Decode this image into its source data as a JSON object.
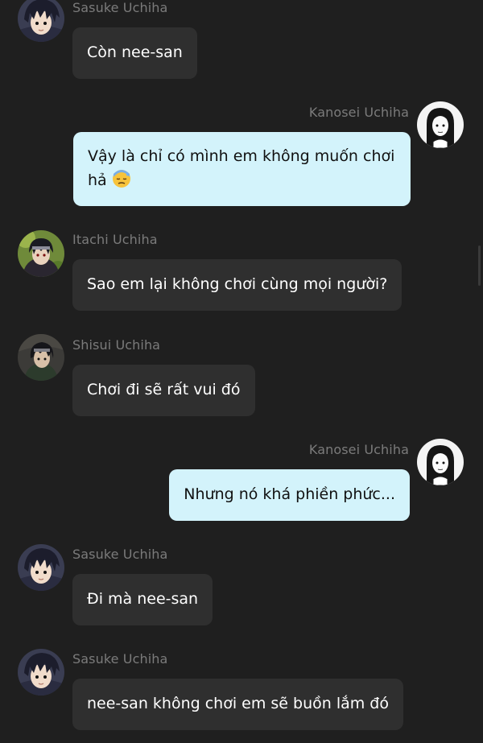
{
  "messages": [
    {
      "sender": "Sasuke Uchiha",
      "avatar": "sasuke-avatar",
      "side": "left",
      "text": "Còn nee-san"
    },
    {
      "sender": "Kanosei Uchiha",
      "avatar": "kanosei-avatar",
      "side": "right",
      "text": "Vậy là chỉ có mình em không muốn chơi hả",
      "emoji": "downcast-sweat-face-icon"
    },
    {
      "sender": "Itachi Uchiha",
      "avatar": "itachi-avatar",
      "side": "left",
      "text": "Sao em lại không chơi cùng mọi người?"
    },
    {
      "sender": "Shisui Uchiha",
      "avatar": "shisui-avatar",
      "side": "left",
      "text": "Chơi đi sẽ rất vui đó"
    },
    {
      "sender": "Kanosei Uchiha",
      "avatar": "kanosei-avatar",
      "side": "right",
      "text": "Nhưng nó khá phiền phức..."
    },
    {
      "sender": "Sasuke Uchiha",
      "avatar": "sasuke-avatar",
      "side": "left",
      "text": "Đi mà nee-san"
    },
    {
      "sender": "Sasuke Uchiha",
      "avatar": "sasuke-avatar",
      "side": "left",
      "text": "nee-san không chơi em sẽ buồn lắm đó"
    }
  ],
  "colors": {
    "background": "#1f1f1f",
    "incoming_bubble": "#2f2f2f",
    "outgoing_bubble": "#d3f3fb",
    "sender_name": "#7b7b7b"
  }
}
